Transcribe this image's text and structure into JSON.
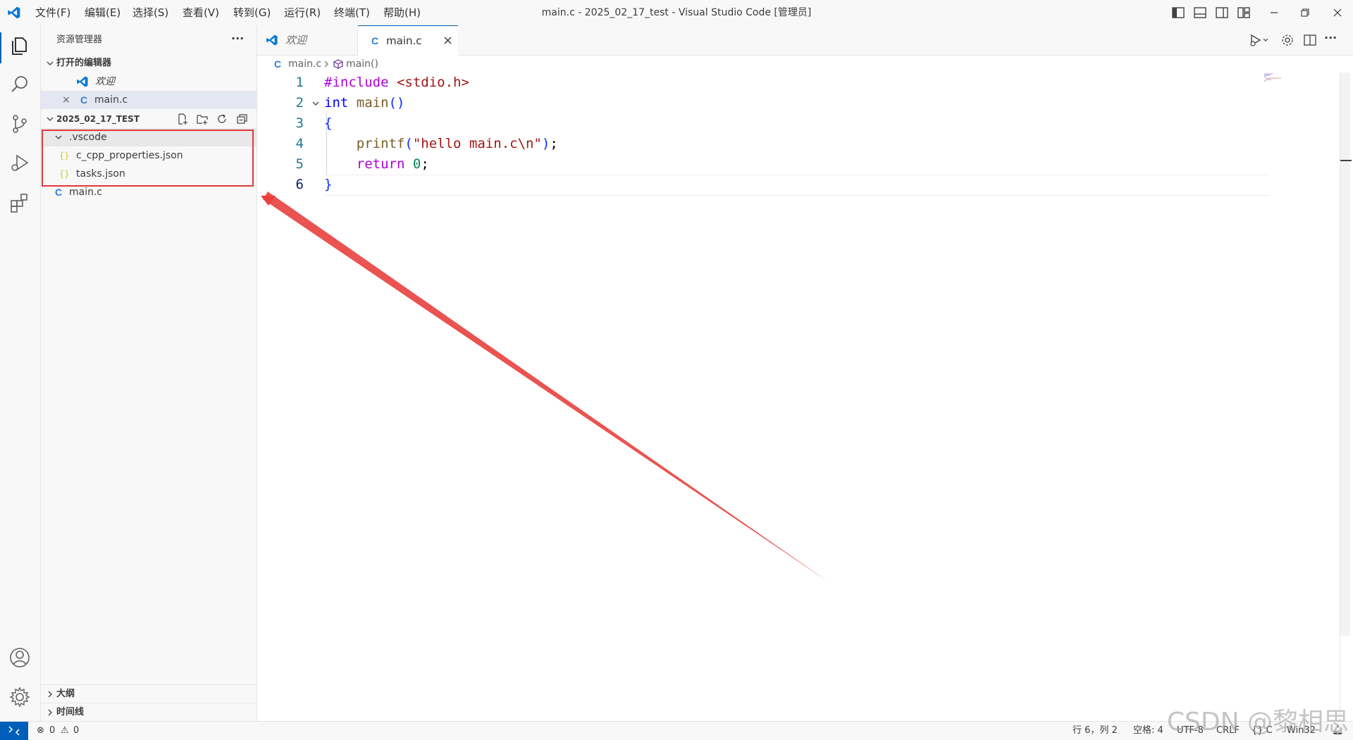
{
  "app": {
    "window_title": "main.c - 2025_02_17_test - Visual Studio Code [管理员]",
    "menu": [
      "文件(F)",
      "编辑(E)",
      "选择(S)",
      "查看(V)",
      "转到(G)",
      "运行(R)",
      "终端(T)",
      "帮助(H)"
    ]
  },
  "sidebar": {
    "title": "资源管理器",
    "more": "···",
    "open_editors": {
      "header": "打开的编辑器",
      "items": [
        {
          "label": "欢迎",
          "icon": "vscode-icon"
        },
        {
          "label": "main.c",
          "icon": "c-file-icon",
          "close": "×"
        }
      ]
    },
    "folder": {
      "header": "2025_02_17_TEST",
      "tree": [
        {
          "label": ".vscode",
          "type": "folder"
        },
        {
          "label": "c_cpp_properties.json",
          "type": "json"
        },
        {
          "label": "tasks.json",
          "type": "json"
        },
        {
          "label": "main.c",
          "type": "c"
        }
      ]
    },
    "outline_label": "大纲",
    "timeline_label": "时间线"
  },
  "tabs": [
    {
      "label": "欢迎",
      "icon": "vscode-icon"
    },
    {
      "label": "main.c",
      "icon": "c-file-icon",
      "close": "×"
    }
  ],
  "breadcrumb": {
    "file": "main.c",
    "symbol": "main()",
    "c_glyph": "C"
  },
  "editor": {
    "line_numbers": [
      "1",
      "2",
      "3",
      "4",
      "5",
      "6"
    ],
    "active_line": 6,
    "code": {
      "l1_pre": "#include",
      "l1_hdr": "<stdio.h>",
      "l2_kw": "int",
      "l2_fn": "main",
      "l2_par": "()",
      "l3": "{",
      "l4_fn": "printf",
      "l4_open": "(",
      "l4_str": "\"hello main.c\\n\"",
      "l4_close": ")",
      "l4_semi": ";",
      "l5_kw": "return",
      "l5_num": "0",
      "l5_semi": ";",
      "l6": "}"
    }
  },
  "statusbar": {
    "errors": "0",
    "warnings": "0",
    "position": "行 6，列 2",
    "spaces": "空格: 4",
    "encoding": "UTF-8",
    "eol": "CRLF",
    "language": "{} C",
    "platform": "Win32"
  },
  "watermark": "CSDN @黎相思",
  "colors": {
    "accent": "#005fb8",
    "highlight_box": "#e0393e",
    "arrow": "#e8403d"
  }
}
